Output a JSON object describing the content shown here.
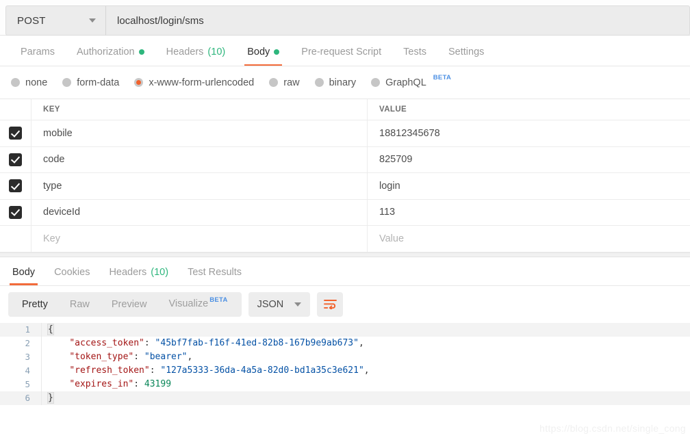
{
  "request": {
    "method": "POST",
    "url": "localhost/login/sms",
    "tabs": [
      {
        "label": "Params",
        "active": false,
        "dot": false,
        "count": null
      },
      {
        "label": "Authorization",
        "active": false,
        "dot": true,
        "count": null
      },
      {
        "label": "Headers",
        "active": false,
        "dot": false,
        "count": "(10)"
      },
      {
        "label": "Body",
        "active": true,
        "dot": true,
        "count": null
      },
      {
        "label": "Pre-request Script",
        "active": false,
        "dot": false,
        "count": null
      },
      {
        "label": "Tests",
        "active": false,
        "dot": false,
        "count": null
      },
      {
        "label": "Settings",
        "active": false,
        "dot": false,
        "count": null
      }
    ],
    "body_types": [
      {
        "label": "none",
        "selected": false,
        "badge": null
      },
      {
        "label": "form-data",
        "selected": false,
        "badge": null
      },
      {
        "label": "x-www-form-urlencoded",
        "selected": true,
        "badge": null
      },
      {
        "label": "raw",
        "selected": false,
        "badge": null
      },
      {
        "label": "binary",
        "selected": false,
        "badge": null
      },
      {
        "label": "GraphQL",
        "selected": false,
        "badge": "BETA"
      }
    ],
    "table": {
      "columns": [
        "KEY",
        "VALUE"
      ],
      "rows": [
        {
          "checked": true,
          "key": "mobile",
          "value": "18812345678"
        },
        {
          "checked": true,
          "key": "code",
          "value": "825709"
        },
        {
          "checked": true,
          "key": "type",
          "value": "login"
        },
        {
          "checked": true,
          "key": "deviceId",
          "value": "113"
        }
      ],
      "placeholder_row": {
        "key": "Key",
        "value": "Value"
      }
    }
  },
  "response": {
    "tabs": [
      {
        "label": "Body",
        "active": true,
        "count": null
      },
      {
        "label": "Cookies",
        "active": false,
        "count": null
      },
      {
        "label": "Headers",
        "active": false,
        "count": "(10)"
      },
      {
        "label": "Test Results",
        "active": false,
        "count": null
      }
    ],
    "view_modes": [
      {
        "label": "Pretty",
        "active": true,
        "badge": null
      },
      {
        "label": "Raw",
        "active": false,
        "badge": null
      },
      {
        "label": "Preview",
        "active": false,
        "badge": null
      },
      {
        "label": "Visualize",
        "active": false,
        "badge": "BETA"
      }
    ],
    "format": "JSON",
    "wrap_icon": "wrap-lines-icon",
    "body_lines": [
      {
        "n": "1",
        "segments": [
          {
            "t": "{",
            "c": "brace"
          }
        ]
      },
      {
        "n": "2",
        "segments": [
          {
            "t": "    ",
            "c": "p"
          },
          {
            "t": "\"access_token\"",
            "c": "k"
          },
          {
            "t": ": ",
            "c": "p"
          },
          {
            "t": "\"45bf7fab-f16f-41ed-82b8-167b9e9ab673\"",
            "c": "s"
          },
          {
            "t": ",",
            "c": "p"
          }
        ]
      },
      {
        "n": "3",
        "segments": [
          {
            "t": "    ",
            "c": "p"
          },
          {
            "t": "\"token_type\"",
            "c": "k"
          },
          {
            "t": ": ",
            "c": "p"
          },
          {
            "t": "\"bearer\"",
            "c": "s"
          },
          {
            "t": ",",
            "c": "p"
          }
        ]
      },
      {
        "n": "4",
        "segments": [
          {
            "t": "    ",
            "c": "p"
          },
          {
            "t": "\"refresh_token\"",
            "c": "k"
          },
          {
            "t": ": ",
            "c": "p"
          },
          {
            "t": "\"127a5333-36da-4a5a-82d0-bd1a35c3e621\"",
            "c": "s"
          },
          {
            "t": ",",
            "c": "p"
          }
        ]
      },
      {
        "n": "5",
        "segments": [
          {
            "t": "    ",
            "c": "p"
          },
          {
            "t": "\"expires_in\"",
            "c": "k"
          },
          {
            "t": ": ",
            "c": "p"
          },
          {
            "t": "43199",
            "c": "n"
          }
        ]
      },
      {
        "n": "6",
        "segments": [
          {
            "t": "}",
            "c": "brace"
          }
        ]
      }
    ]
  },
  "watermark": "https://blog.csdn.net/single_cong",
  "colors": {
    "accent": "#f26b3a",
    "green": "#2eb67d",
    "beta_blue": "#4b8fe3",
    "json_key": "#a31515",
    "json_string": "#0451a5",
    "json_number": "#098658",
    "line_number": "#8aa0b5"
  }
}
